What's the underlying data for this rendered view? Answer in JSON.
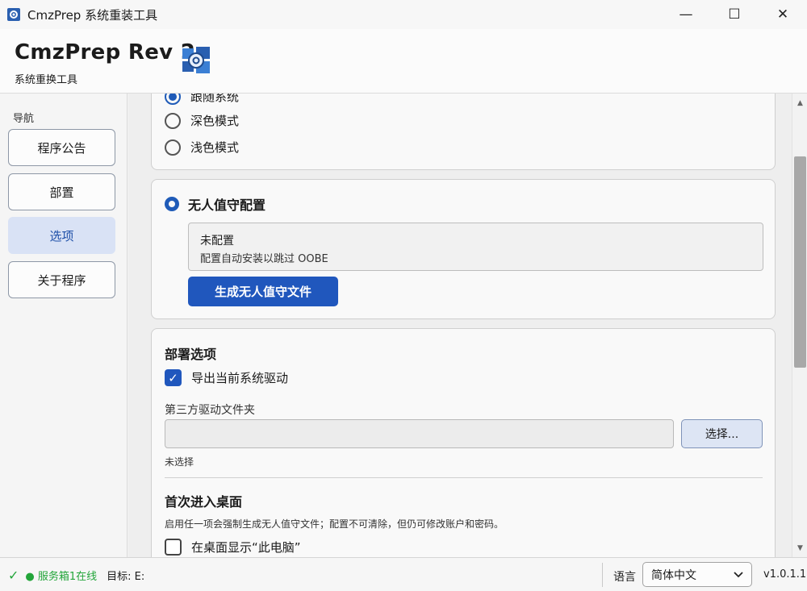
{
  "window": {
    "title": "CmzPrep 系统重装工具",
    "controls": {
      "minimize": "—",
      "maximize": "☐",
      "close": "✕"
    }
  },
  "header": {
    "brand": "CmzPrep Rev 2",
    "subtitle": "系统重换工具"
  },
  "sidebar": {
    "label": "导航",
    "items": [
      {
        "label": "程序公告",
        "active": false
      },
      {
        "label": "部置",
        "active": false
      },
      {
        "label": "选项",
        "active": true
      },
      {
        "label": "关于程序",
        "active": false
      }
    ]
  },
  "theme_card": {
    "options": [
      {
        "label": "跟随系统",
        "checked": true
      },
      {
        "label": "深色模式",
        "checked": false
      },
      {
        "label": "浅色模式",
        "checked": false
      }
    ]
  },
  "unattend_card": {
    "title": "无人值守配置",
    "status": "未配置",
    "description": "配置自动安装以跳过 OOBE",
    "button": "生成无人值守文件"
  },
  "deploy_card": {
    "title": "部署选项",
    "export_drivers": {
      "label": "导出当前系统驱动",
      "checked": true
    },
    "driver_folder_label": "第三方驱动文件夹",
    "driver_folder_value": "",
    "choose_button": "选择...",
    "not_selected": "未选择",
    "desktop_title": "首次进入桌面",
    "desktop_desc": "启用任一项会强制生成无人值守文件；配置不可清除，但仍可修改账户和密码。",
    "show_pc": {
      "label": "在桌面显示“此电脑”",
      "checked": false
    }
  },
  "statusbar": {
    "online": "● 服务箱1在线",
    "target": "目标: E:",
    "language_label": "语言",
    "language_value": "简体中文",
    "version": "v1.0.1.1"
  },
  "colors": {
    "accent": "#2057bd",
    "active_nav_bg": "#d9e2f5",
    "online_green": "#23a53a"
  }
}
